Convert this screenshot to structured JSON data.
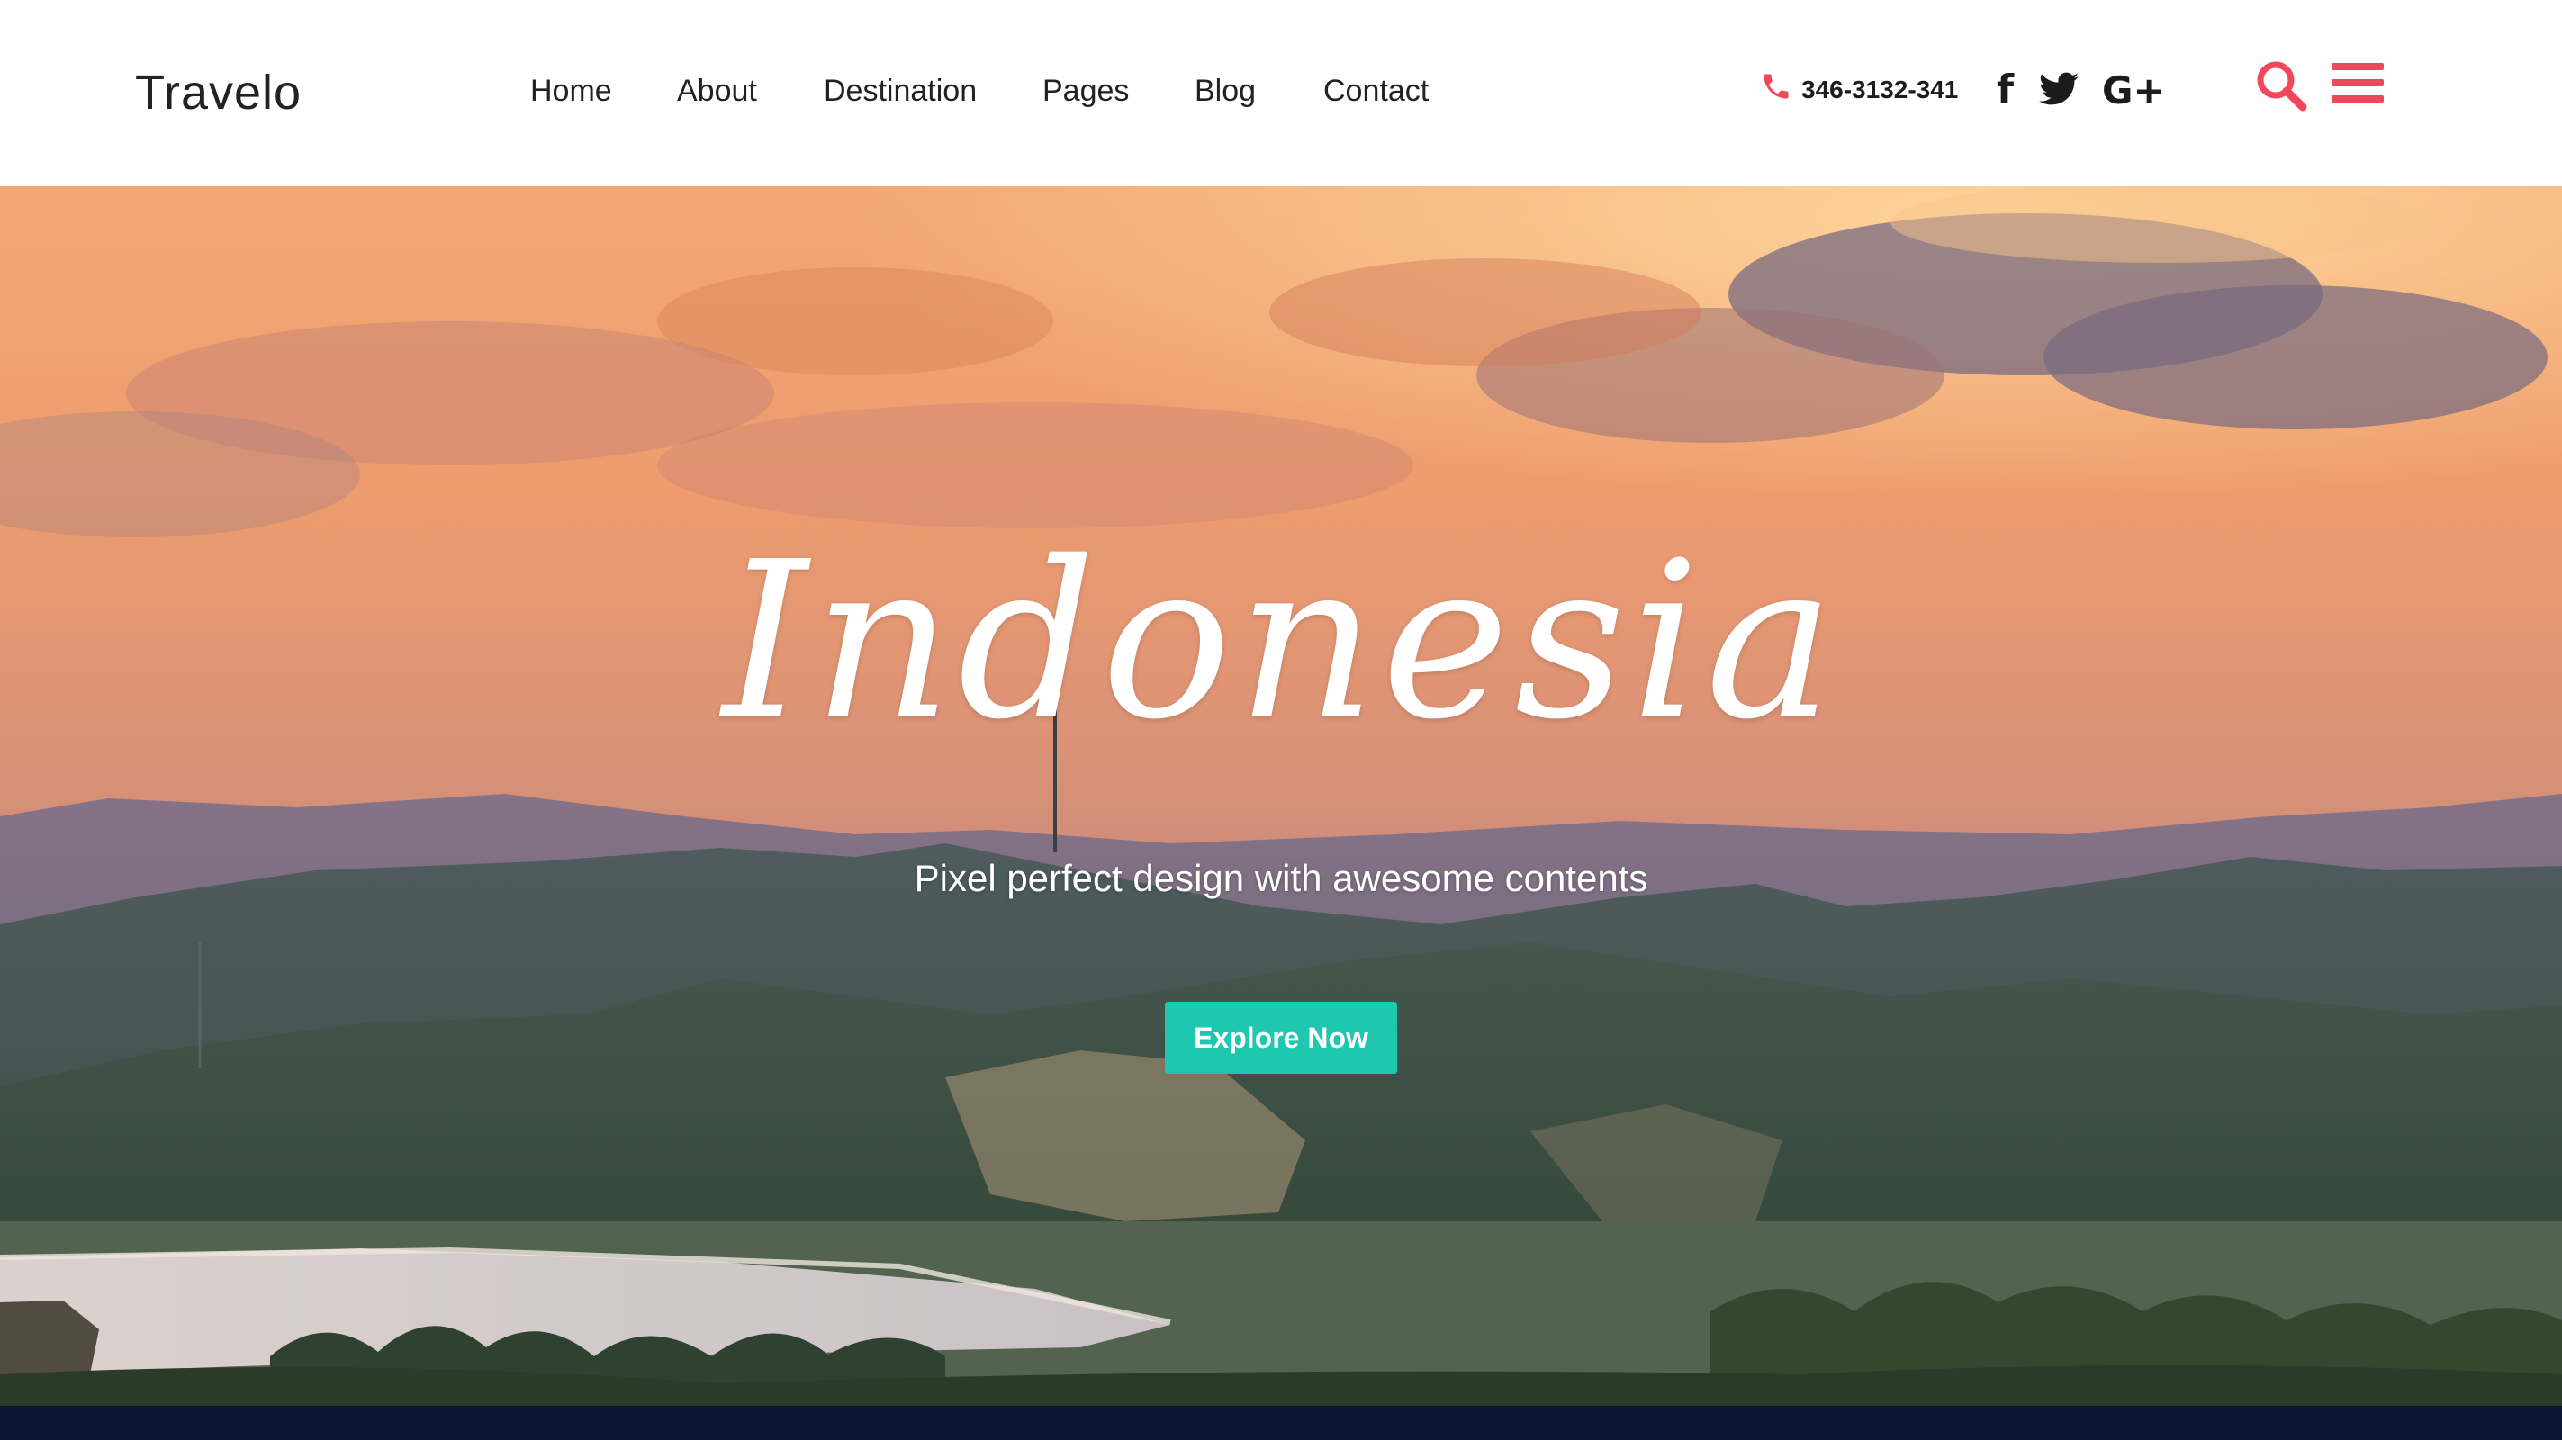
{
  "header": {
    "logo": "Travelo",
    "nav": [
      {
        "label": "Home"
      },
      {
        "label": "About"
      },
      {
        "label": "Destination"
      },
      {
        "label": "Pages"
      },
      {
        "label": "Blog"
      },
      {
        "label": "Contact"
      }
    ],
    "phone": "346-3132-341",
    "phone_icon": "phone-icon",
    "social": [
      {
        "name": "facebook-icon",
        "glyph": "f"
      },
      {
        "name": "twitter-icon"
      },
      {
        "name": "google-plus-icon",
        "glyph": "G+"
      }
    ],
    "search_icon": "search-icon",
    "menu_icon": "hamburger-menu-icon"
  },
  "hero": {
    "title": "Indonesia",
    "subtitle": "Pixel perfect design with awesome contents",
    "cta_label": "Explore Now"
  },
  "colors": {
    "accent": "#f0485a",
    "cta": "#1ec7b0",
    "footer_bar": "#0b1632",
    "text_dark": "#222222"
  }
}
